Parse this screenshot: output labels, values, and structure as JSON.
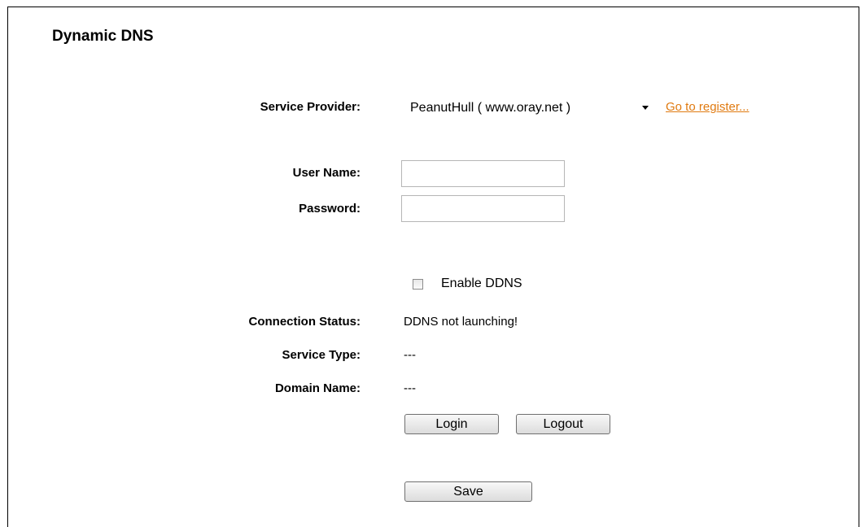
{
  "page": {
    "title": "Dynamic DNS"
  },
  "form": {
    "service_provider_label": "Service Provider:",
    "service_provider_value": "PeanutHull ( www.oray.net )",
    "register_link": "Go to register...",
    "username_label": "User Name:",
    "username_value": "",
    "password_label": "Password:",
    "password_value": "",
    "enable_ddns_label": "Enable DDNS",
    "enable_ddns_checked": false
  },
  "status": {
    "connection_status_label": "Connection Status:",
    "connection_status_value": "DDNS not launching!",
    "service_type_label": "Service Type:",
    "service_type_value": "---",
    "domain_name_label": "Domain Name:",
    "domain_name_value": "---"
  },
  "buttons": {
    "login": "Login",
    "logout": "Logout",
    "save": "Save"
  }
}
